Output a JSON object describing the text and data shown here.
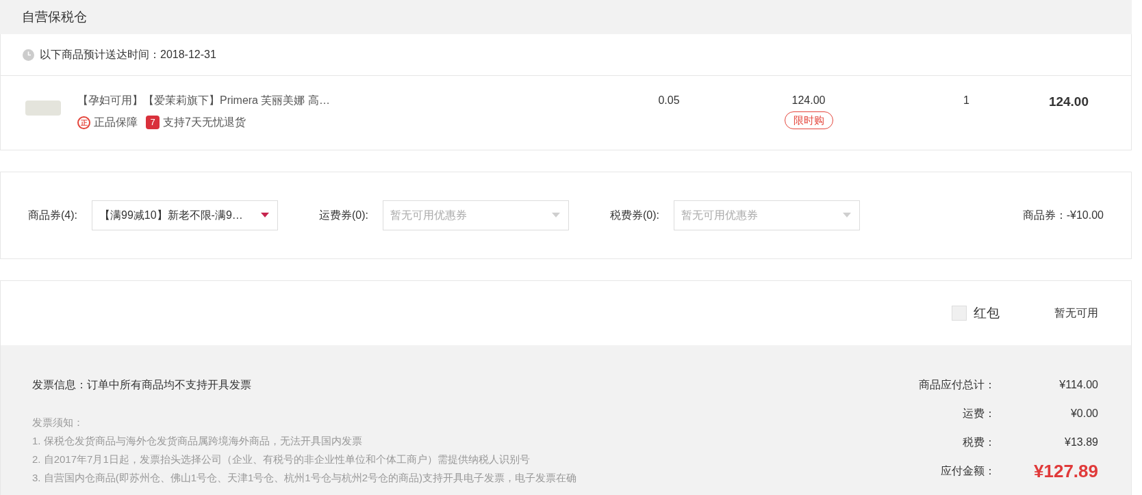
{
  "section_title": "自营保税仓",
  "delivery": {
    "text": "以下商品预计送达时间：2018-12-31"
  },
  "items": [
    {
      "name": "【孕妇可用】【爱茉莉旗下】Primera 芙丽美娜 高…",
      "tags": [
        {
          "kind": "circle",
          "icon": "正",
          "label": "正品保障"
        },
        {
          "kind": "square",
          "icon": "7",
          "label": "支持7天无忧退货"
        }
      ],
      "tax": "0.05",
      "price": "124.00",
      "badge": "限时购",
      "quantity": "1",
      "subtotal": "124.00"
    }
  ],
  "coupons": [
    {
      "label": "商品券(4):",
      "value": "【满99减10】新老不限-满9…",
      "disabled": false
    },
    {
      "label": "运费券(0):",
      "placeholder": "暂无可用优惠券",
      "disabled": true
    },
    {
      "label": "税费券(0):",
      "placeholder": "暂无可用优惠券",
      "disabled": true
    }
  ],
  "coupon_discount": "商品券：-¥10.00",
  "hongbao": {
    "label": "红包",
    "checked": false,
    "status": "暂无可用"
  },
  "invoice": {
    "info": "发票信息：订单中所有商品均不支持开具发票",
    "notes_title": "发票须知：",
    "notes": [
      "1. 保税仓发货商品与海外仓发货商品属跨境海外商品，无法开具国内发票",
      "2. 自2017年7月1日起，发票抬头选择公司（企业、有税号的非企业性单位和个体工商户）需提供纳税人识别号",
      "3. 自营国内仓商品(即苏州仓、佛山1号仓、天津1号仓、杭州1号仓与杭州2号仓的商品)支持开具电子发票，电子发票在确"
    ]
  },
  "totals": [
    {
      "kind": "line",
      "label": "商品应付总计：",
      "value": "¥114.00"
    },
    {
      "kind": "line",
      "label": "运费：",
      "value": "¥0.00"
    },
    {
      "kind": "line",
      "label": "税费：",
      "value": "¥13.89"
    },
    {
      "kind": "total",
      "label": "应付金额：",
      "value": "¥127.89"
    }
  ]
}
